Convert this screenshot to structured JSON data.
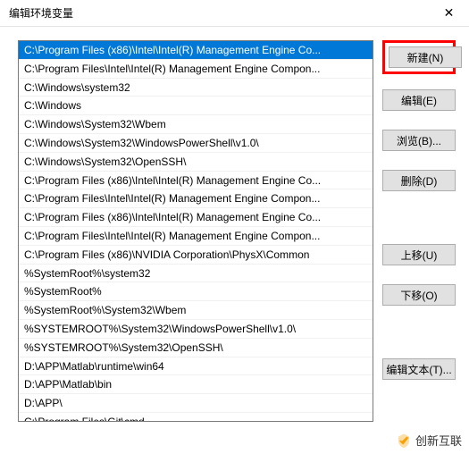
{
  "titlebar": {
    "title": "编辑环境变量",
    "close": "✕"
  },
  "list": {
    "items": [
      "C:\\Program Files (x86)\\Intel\\Intel(R) Management Engine Co...",
      "C:\\Program Files\\Intel\\Intel(R) Management Engine Compon...",
      "C:\\Windows\\system32",
      "C:\\Windows",
      "C:\\Windows\\System32\\Wbem",
      "C:\\Windows\\System32\\WindowsPowerShell\\v1.0\\",
      "C:\\Windows\\System32\\OpenSSH\\",
      "C:\\Program Files (x86)\\Intel\\Intel(R) Management Engine Co...",
      "C:\\Program Files\\Intel\\Intel(R) Management Engine Compon...",
      "C:\\Program Files (x86)\\Intel\\Intel(R) Management Engine Co...",
      "C:\\Program Files\\Intel\\Intel(R) Management Engine Compon...",
      "C:\\Program Files (x86)\\NVIDIA Corporation\\PhysX\\Common",
      "%SystemRoot%\\system32",
      "%SystemRoot%",
      "%SystemRoot%\\System32\\Wbem",
      "%SYSTEMROOT%\\System32\\WindowsPowerShell\\v1.0\\",
      "%SYSTEMROOT%\\System32\\OpenSSH\\",
      "D:\\APP\\Matlab\\runtime\\win64",
      "D:\\APP\\Matlab\\bin",
      "D:\\APP\\",
      "C:\\Program Files\\Git\\cmd"
    ],
    "selected_index": 0
  },
  "buttons": {
    "new": "新建(N)",
    "edit": "编辑(E)",
    "browse": "浏览(B)...",
    "delete": "删除(D)",
    "move_up": "上移(U)",
    "move_down": "下移(O)",
    "edit_text": "编辑文本(T)..."
  },
  "watermark": {
    "text": "创新互联"
  }
}
